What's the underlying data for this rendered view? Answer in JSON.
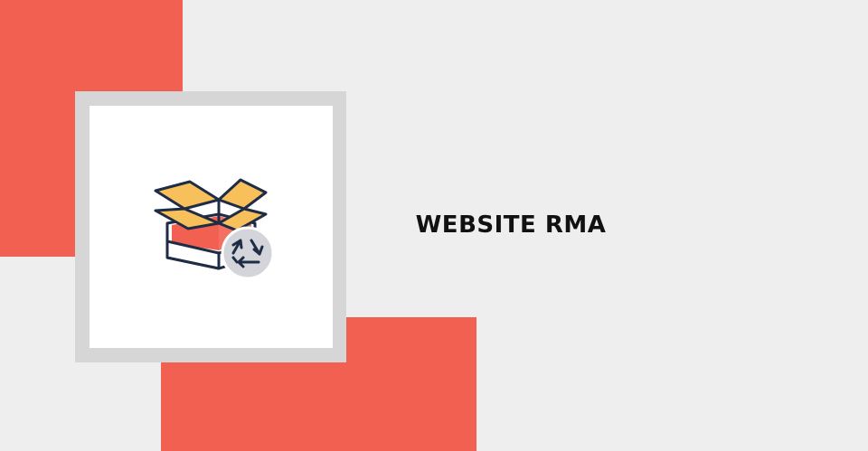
{
  "banner": {
    "title": "WEBSITE RMA",
    "icon": "box-return-recycle-icon"
  },
  "colors": {
    "background": "#eeeeee",
    "accent_red": "#f26052",
    "frame_gray": "#d6d6d6",
    "card_white": "#ffffff",
    "box_yellow": "#f8c05a",
    "box_red": "#f26052",
    "outline_navy": "#1f2c45",
    "badge_gray": "#d3d5da",
    "title_color": "#111111"
  }
}
